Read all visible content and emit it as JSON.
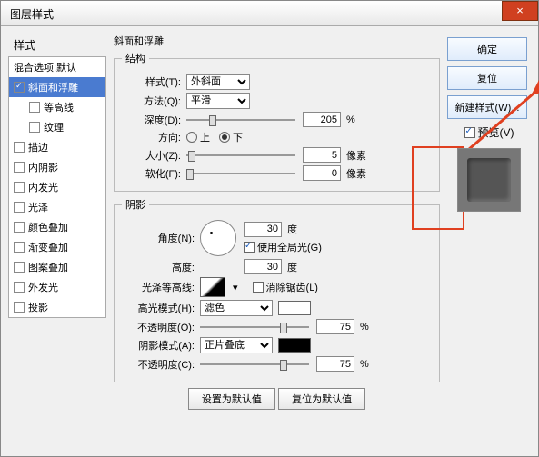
{
  "window": {
    "title": "图层样式"
  },
  "left": {
    "header": "样式",
    "blend": "混合选项:默认",
    "items": [
      {
        "label": "斜面和浮雕",
        "checked": true,
        "active": true
      },
      {
        "label": "等高线",
        "checked": false,
        "indent": true
      },
      {
        "label": "纹理",
        "checked": false,
        "indent": true
      },
      {
        "label": "描边",
        "checked": false
      },
      {
        "label": "内阴影",
        "checked": false
      },
      {
        "label": "内发光",
        "checked": false
      },
      {
        "label": "光泽",
        "checked": false
      },
      {
        "label": "颜色叠加",
        "checked": false
      },
      {
        "label": "渐变叠加",
        "checked": false
      },
      {
        "label": "图案叠加",
        "checked": false
      },
      {
        "label": "外发光",
        "checked": false
      },
      {
        "label": "投影",
        "checked": false
      }
    ]
  },
  "bevel": {
    "title": "斜面和浮雕",
    "structure": {
      "legend": "结构",
      "style_label": "样式(T):",
      "style_value": "外斜面",
      "technique_label": "方法(Q):",
      "technique_value": "平滑",
      "depth_label": "深度(D):",
      "depth_value": "205",
      "depth_unit": "%",
      "direction_label": "方向:",
      "up": "上",
      "down": "下",
      "size_label": "大小(Z):",
      "size_value": "5",
      "size_unit": "像素",
      "soften_label": "软化(F):",
      "soften_value": "0",
      "soften_unit": "像素"
    },
    "shading": {
      "legend": "阴影",
      "angle_label": "角度(N):",
      "angle_value": "30",
      "angle_unit": "度",
      "global_light": "使用全局光(G)",
      "altitude_label": "高度:",
      "altitude_value": "30",
      "altitude_unit": "度",
      "gloss_label": "光泽等高线:",
      "antialias": "消除锯齿(L)",
      "highlight_mode_label": "高光模式(H):",
      "highlight_mode": "滤色",
      "highlight_opacity_label": "不透明度(O):",
      "highlight_opacity": "75",
      "opacity_unit": "%",
      "shadow_mode_label": "阴影模式(A):",
      "shadow_mode": "正片叠底",
      "shadow_opacity_label": "不透明度(C):",
      "shadow_opacity": "75"
    },
    "btn_default": "设置为默认值",
    "btn_reset": "复位为默认值"
  },
  "right": {
    "ok": "确定",
    "cancel": "复位",
    "new_style": "新建样式(W)...",
    "preview": "预览(V)"
  }
}
